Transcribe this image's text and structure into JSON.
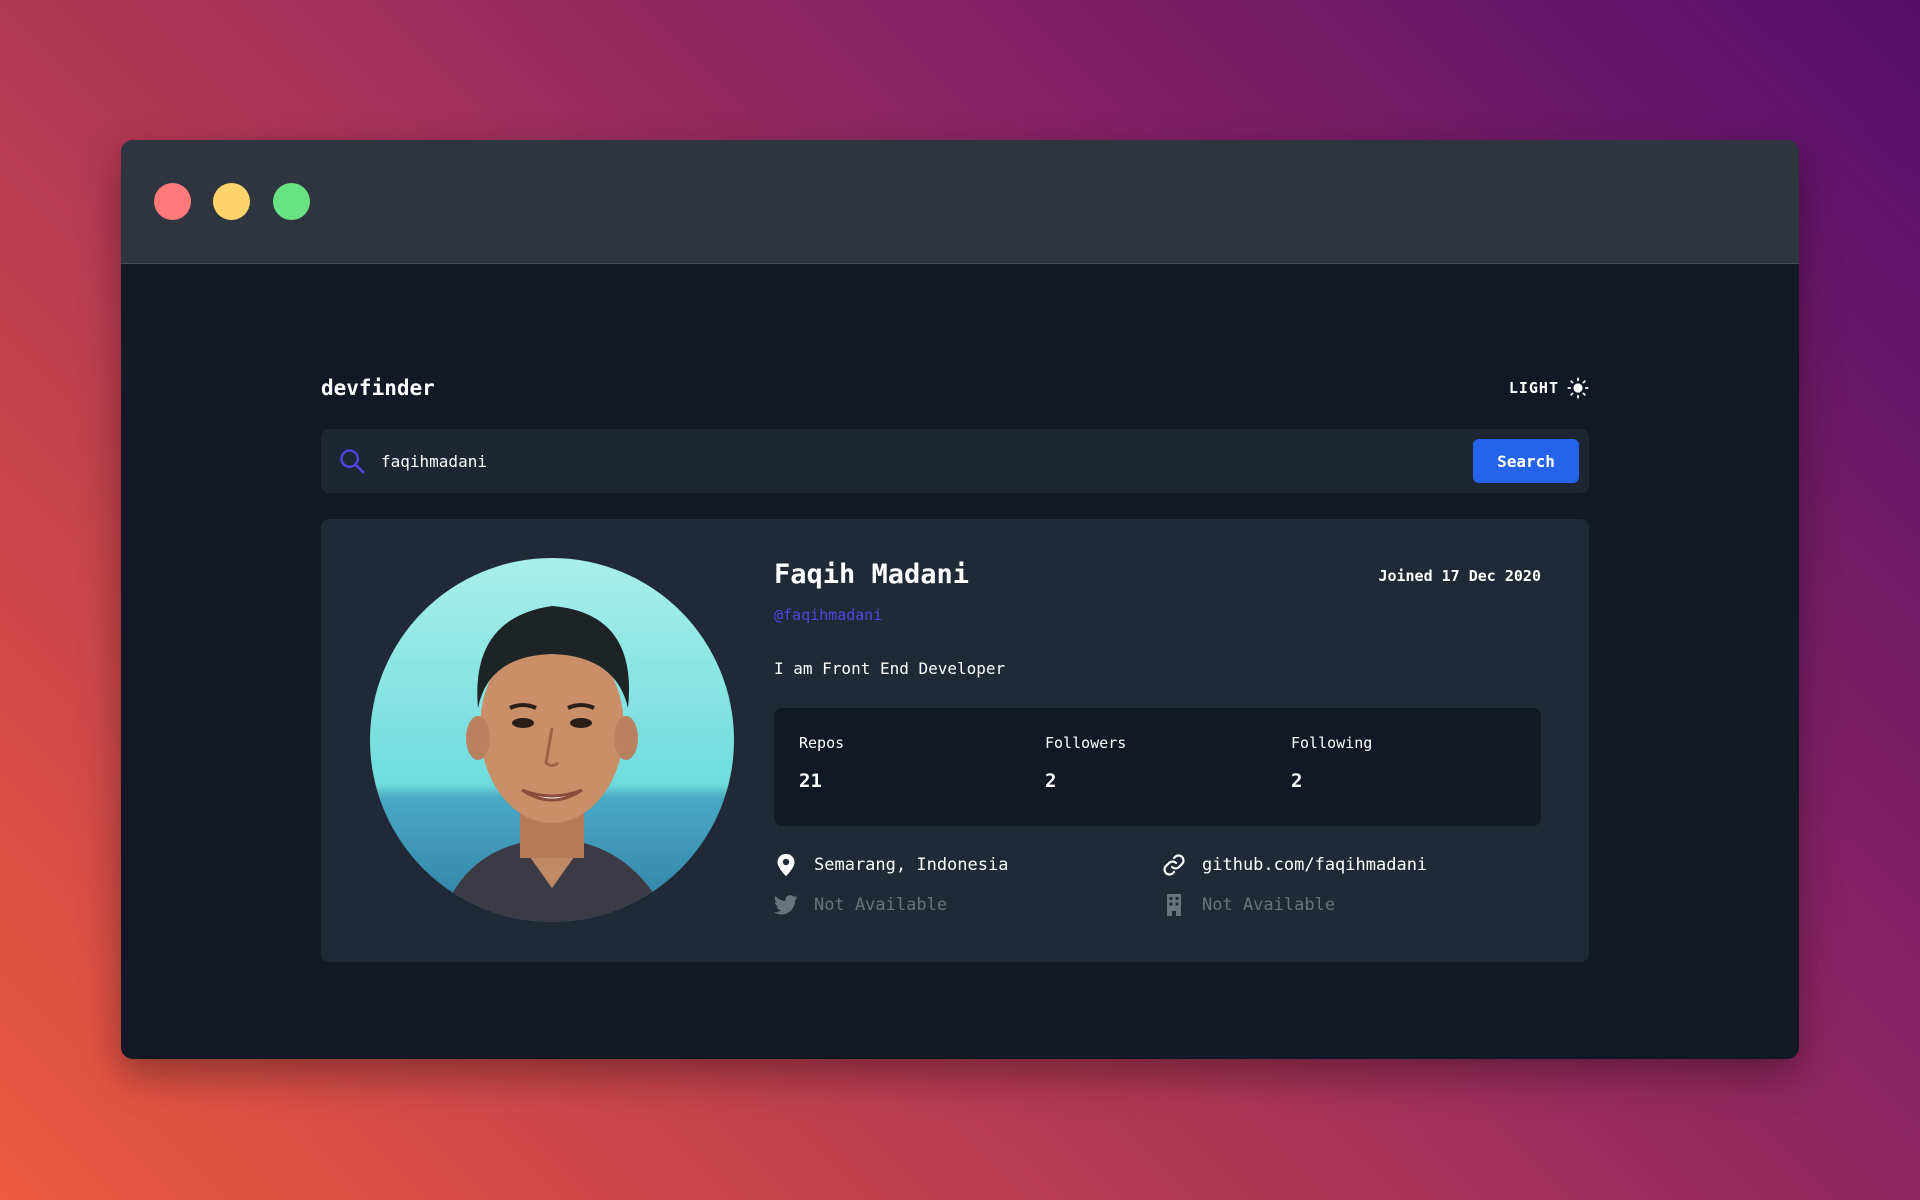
{
  "window": {
    "traffic_lights": {
      "close_color": "#ff7b7b",
      "minimize_color": "#ffd46b",
      "maximize_color": "#69e283"
    }
  },
  "app": {
    "logo": "devfinder",
    "theme_toggle": {
      "label": "LIGHT",
      "icon": "sun-icon"
    }
  },
  "search": {
    "value": "faqihmadani",
    "icon": "search-icon",
    "button_label": "Search"
  },
  "profile": {
    "name": "Faqih Madani",
    "joined": "Joined 17 Dec 2020",
    "handle": "@faqihmadani",
    "bio": "I am Front End Developer",
    "stats": [
      {
        "label": "Repos",
        "value": "21"
      },
      {
        "label": "Followers",
        "value": "2"
      },
      {
        "label": "Following",
        "value": "2"
      }
    ],
    "links": {
      "location": {
        "text": "Semarang, Indonesia",
        "icon": "location-pin-icon"
      },
      "website": {
        "text": "github.com/faqihmadani",
        "icon": "link-icon"
      },
      "twitter": {
        "text": "Not Available",
        "icon": "twitter-icon"
      },
      "company": {
        "text": "Not Available",
        "icon": "building-icon"
      }
    }
  },
  "colors": {
    "accent": "#2563eb",
    "handle": "#4f46e5",
    "muted": "#6b7280",
    "card_bg": "#1f2937",
    "app_bg": "#121826"
  }
}
